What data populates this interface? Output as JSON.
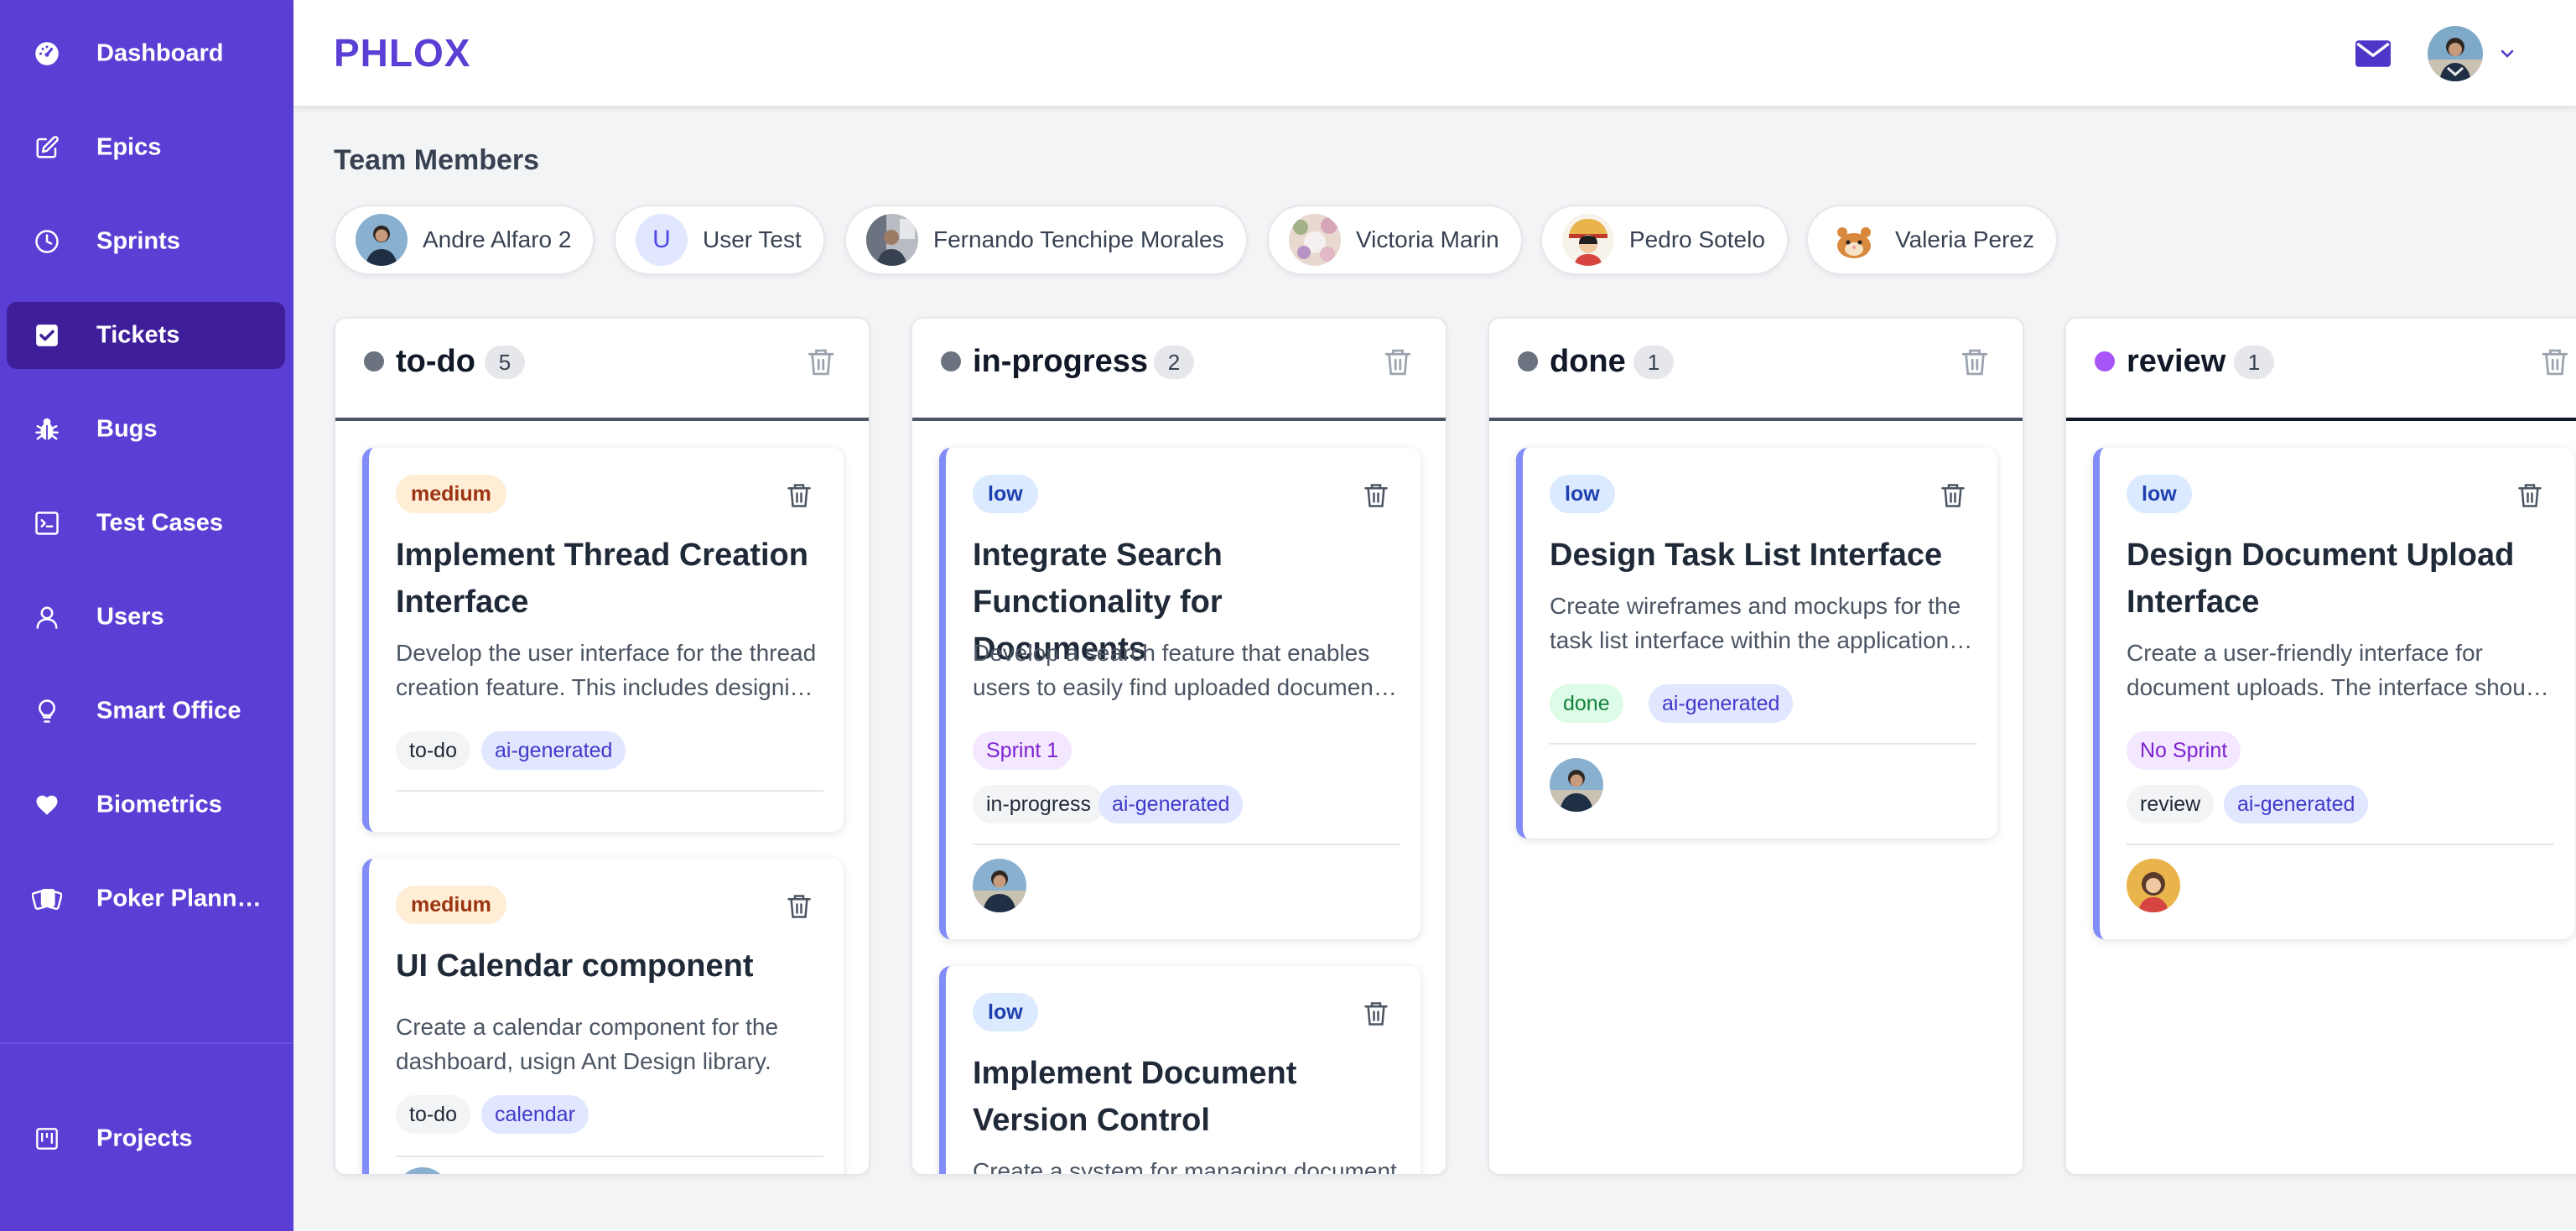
{
  "sidebar": {
    "items": [
      {
        "label": "Dashboard",
        "icon": "dashboard-icon"
      },
      {
        "label": "Epics",
        "icon": "edit-icon"
      },
      {
        "label": "Sprints",
        "icon": "clock-icon"
      },
      {
        "label": "Tickets",
        "icon": "checkbox-icon",
        "active": true
      },
      {
        "label": "Bugs",
        "icon": "bug-icon"
      },
      {
        "label": "Test Cases",
        "icon": "terminal-icon"
      },
      {
        "label": "Users",
        "icon": "user-icon"
      },
      {
        "label": "Smart Office",
        "icon": "lightbulb-icon"
      },
      {
        "label": "Biometrics",
        "icon": "heart-icon"
      },
      {
        "label": "Poker Plann…",
        "icon": "cards-icon"
      }
    ],
    "footer_item": {
      "label": "Projects",
      "icon": "project-icon"
    }
  },
  "header": {
    "logo": "PHLOX",
    "mail_icon": "mail-icon",
    "dropdown_icon": "chevron-down-icon"
  },
  "team": {
    "title": "Team Members",
    "members": [
      {
        "name": "Andre Alfaro 2"
      },
      {
        "name": "User Test",
        "initial": "U"
      },
      {
        "name": "Fernando Tenchipe Morales"
      },
      {
        "name": "Victoria Marin"
      },
      {
        "name": "Pedro Sotelo"
      },
      {
        "name": "Valeria Perez"
      }
    ]
  },
  "board": {
    "columns": [
      {
        "title": "to-do",
        "count": "5",
        "dot_color": "#6b7280",
        "cards": [
          {
            "priority": "medium",
            "title": "Implement Thread Creation Interface",
            "description": "Develop the user interface for the thread creation feature. This includes designing the form fields and layout.",
            "tags": [
              "to-do",
              "ai-generated"
            ]
          },
          {
            "priority": "medium",
            "title": "UI Calendar component",
            "description": "Create a calendar component for the dashboard, usign Ant Design library.",
            "tags": [
              "to-do",
              "calendar"
            ]
          }
        ]
      },
      {
        "title": "in-progress",
        "count": "2",
        "dot_color": "#6b7280",
        "cards": [
          {
            "priority": "low",
            "title": "Integrate Search Functionality for Documents",
            "description": "Develop a search feature that enables users to easily find uploaded documents by name or content.",
            "sprint": "Sprint 1",
            "tags": [
              "in-progress",
              "ai-generated"
            ]
          },
          {
            "priority": "low",
            "title": "Implement Document Version Control",
            "description": "Create a system for managing document versions."
          }
        ]
      },
      {
        "title": "done",
        "count": "1",
        "dot_color": "#6b7280",
        "cards": [
          {
            "priority": "low",
            "title": "Design Task List Interface",
            "description": "Create wireframes and mockups for the task list interface within the application dashboard.",
            "tags": [
              "done",
              "ai-generated"
            ]
          }
        ]
      },
      {
        "title": "review",
        "count": "1",
        "dot_color": "#a855f7",
        "cards": [
          {
            "priority": "low",
            "title": "Design Document Upload Interface",
            "description": "Create a user-friendly interface for document uploads. The interface should support drag and drop.",
            "sprint": "No Sprint",
            "tags": [
              "review",
              "ai-generated"
            ]
          }
        ]
      }
    ]
  },
  "colors": {
    "sidebar": "#5b3fd5",
    "sidebar_active": "#3f1e9a",
    "accent": "#5b3fd5",
    "card_border": "#818cf8"
  }
}
